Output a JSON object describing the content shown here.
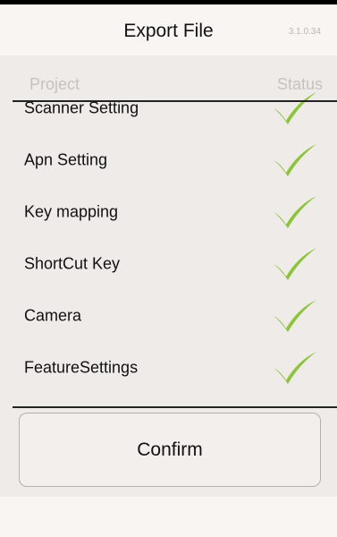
{
  "header": {
    "title": "Export File",
    "version": "3.1.0.34"
  },
  "columns": {
    "project": "Project",
    "status": "Status"
  },
  "items": [
    {
      "label": "Scanner Setting",
      "status_icon": "check-icon"
    },
    {
      "label": "Apn Setting",
      "status_icon": "check-icon"
    },
    {
      "label": "Key mapping",
      "status_icon": "check-icon"
    },
    {
      "label": "ShortCut Key",
      "status_icon": "check-icon"
    },
    {
      "label": "Camera",
      "status_icon": "check-icon"
    },
    {
      "label": "FeatureSettings",
      "status_icon": "check-icon"
    }
  ],
  "actions": {
    "confirm_label": "Confirm"
  },
  "colors": {
    "check": "#8cc43a",
    "divider": "#222222",
    "background": "#f8f5f3",
    "panel": "#efebe8"
  }
}
